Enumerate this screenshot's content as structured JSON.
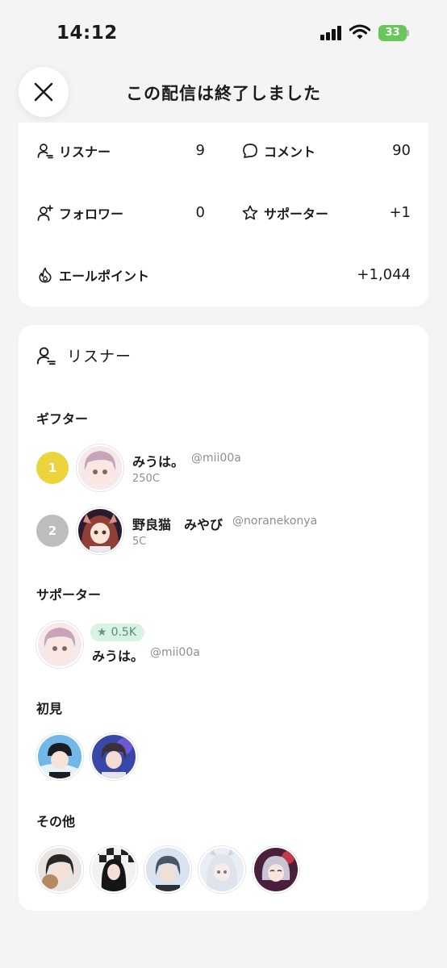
{
  "status_bar": {
    "time": "14:12",
    "battery": "33"
  },
  "header": {
    "title": "この配信は終了しました",
    "close_icon": "close-icon"
  },
  "stats": {
    "listeners": {
      "label": "リスナー",
      "value": "9",
      "icon": "user-icon"
    },
    "comments": {
      "label": "コメント",
      "value": "90",
      "icon": "comment-icon"
    },
    "followers": {
      "label": "フォロワー",
      "value": "0",
      "icon": "user-plus-icon"
    },
    "supporters": {
      "label": "サポーター",
      "value": "+1",
      "icon": "star-outline-icon"
    },
    "yell_points": {
      "label": "エールポイント",
      "value": "+1,044",
      "icon": "flame-icon"
    }
  },
  "listener_card": {
    "title": "リスナー",
    "gifters_title": "ギフター",
    "gifters": [
      {
        "rank": "1",
        "name": "みうは。",
        "handle": "@mii00a",
        "amount": "250C",
        "rank_color": "#ecd43c"
      },
      {
        "rank": "2",
        "name": "野良猫　みやび",
        "handle": "@noranekonya",
        "amount": "5C",
        "rank_color": "#bdbdbd"
      }
    ],
    "supporters_title": "サポーター",
    "supporter": {
      "badge": "0.5K",
      "name": "みうは。",
      "handle": "@mii00a"
    },
    "first_time_title": "初見",
    "others_title": "その他"
  }
}
